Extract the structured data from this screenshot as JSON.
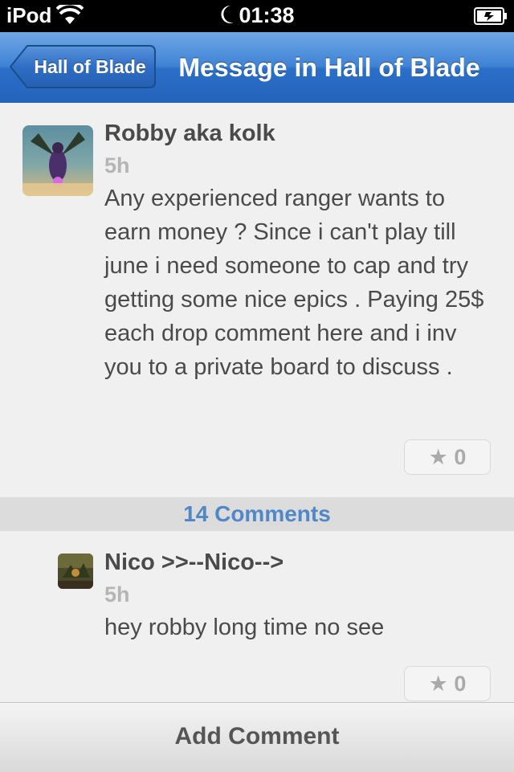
{
  "status_bar": {
    "carrier": "iPod",
    "time": "01:38",
    "icons": [
      "wifi-icon",
      "moon-icon",
      "battery-charging-icon"
    ]
  },
  "nav": {
    "back_label": "Hall of Blade",
    "title": "Message in Hall of Blade",
    "accent": "#3f83d6"
  },
  "post": {
    "author": "Robby aka kolk",
    "time": "5h",
    "body": "Any experienced ranger wants to earn money ? Since i can't play till june i need someone to cap and try getting some nice epics . Paying 25$ each drop comment here and i inv you to a private board to discuss .",
    "likes": "0"
  },
  "comments_header": "14 Comments",
  "comments": [
    {
      "author": "Nico >>--Nico-->",
      "time": "5h",
      "body": "hey robby long time no see",
      "likes": "0"
    }
  ],
  "bottom_bar": {
    "add_comment_label": "Add Comment"
  },
  "colors": {
    "link_blue": "#4f87c9",
    "text": "#4a4a4a",
    "muted": "#b5b5b5"
  }
}
